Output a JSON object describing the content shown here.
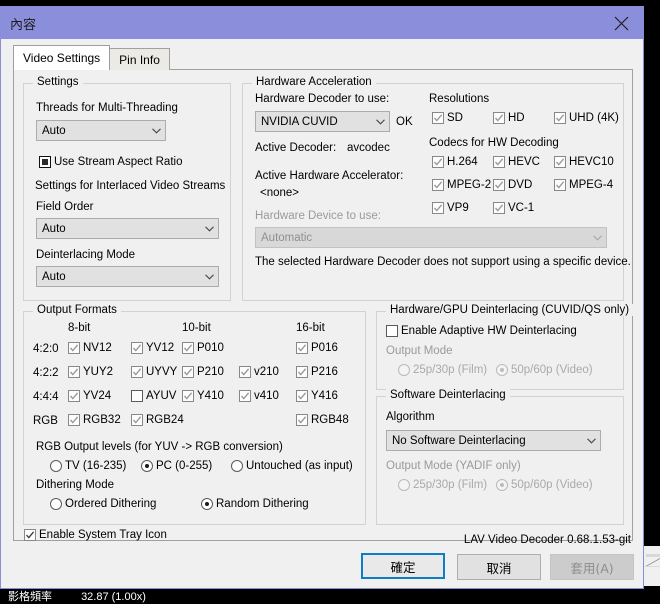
{
  "window": {
    "title": "內容",
    "close_icon": "close-icon"
  },
  "tabs": [
    {
      "label": "Video Settings",
      "active": true
    },
    {
      "label": "Pin Info",
      "active": false
    }
  ],
  "settings_group": {
    "legend": "Settings",
    "threads_label": "Threads for Multi-Threading",
    "threads_value": "Auto",
    "use_stream_aspect_ratio": "Use Stream Aspect Ratio",
    "interlaced_header": "Settings for Interlaced Video Streams",
    "field_order_label": "Field Order",
    "field_order_value": "Auto",
    "deinterlacing_mode_label": "Deinterlacing Mode",
    "deinterlacing_mode_value": "Auto"
  },
  "hw_accel": {
    "legend": "Hardware Acceleration",
    "decoder_label": "Hardware Decoder to use:",
    "decoder_value": "NVIDIA CUVID",
    "ok_text": "OK",
    "active_decoder_label": "Active Decoder:",
    "active_decoder_value": "avcodec",
    "active_accel_label": "Active Hardware Accelerator:",
    "active_accel_value": "<none>",
    "device_label": "Hardware Device to use:",
    "device_value": "Automatic",
    "note": "The selected Hardware Decoder does not support using a specific device.",
    "resolutions_label": "Resolutions",
    "resolutions": [
      {
        "label": "SD",
        "checked": true
      },
      {
        "label": "HD",
        "checked": true
      },
      {
        "label": "UHD (4K)",
        "checked": true
      }
    ],
    "codecs_label": "Codecs for HW Decoding",
    "codecs": [
      {
        "label": "H.264",
        "checked": true
      },
      {
        "label": "HEVC",
        "checked": true
      },
      {
        "label": "HEVC10",
        "checked": true
      },
      {
        "label": "MPEG-2",
        "checked": true
      },
      {
        "label": "DVD",
        "checked": true
      },
      {
        "label": "MPEG-4",
        "checked": true
      },
      {
        "label": "VP9",
        "checked": true
      },
      {
        "label": "VC-1",
        "checked": true
      }
    ]
  },
  "output_formats": {
    "legend": "Output Formats",
    "col_headers": [
      "8-bit",
      "10-bit",
      "16-bit"
    ],
    "row_labels": [
      "4:2:0",
      "4:2:2",
      "4:4:4",
      "RGB"
    ],
    "items": [
      {
        "label": "NV12",
        "checked": true
      },
      {
        "label": "YV12",
        "checked": true
      },
      {
        "label": "P010",
        "checked": true
      },
      {
        "label": "P016",
        "checked": true
      },
      {
        "label": "YUY2",
        "checked": true
      },
      {
        "label": "UYVY",
        "checked": true
      },
      {
        "label": "P210",
        "checked": true
      },
      {
        "label": "v210",
        "checked": true
      },
      {
        "label": "P216",
        "checked": true
      },
      {
        "label": "YV24",
        "checked": true
      },
      {
        "label": "AYUV",
        "checked": false
      },
      {
        "label": "Y410",
        "checked": true
      },
      {
        "label": "v410",
        "checked": true
      },
      {
        "label": "Y416",
        "checked": true
      },
      {
        "label": "RGB32",
        "checked": true
      },
      {
        "label": "RGB24",
        "checked": true
      },
      {
        "label": "RGB48",
        "checked": true
      }
    ],
    "rgb_levels_label": "RGB Output levels (for YUV -> RGB conversion)",
    "rgb_levels": [
      {
        "label": "TV (16-235)",
        "selected": false
      },
      {
        "label": "PC (0-255)",
        "selected": true
      },
      {
        "label": "Untouched (as input)",
        "selected": false
      }
    ],
    "dithering_label": "Dithering Mode",
    "dithering": [
      {
        "label": "Ordered Dithering",
        "selected": false
      },
      {
        "label": "Random Dithering",
        "selected": true
      }
    ]
  },
  "hw_deint": {
    "legend": "Hardware/GPU Deinterlacing (CUVID/QS only)",
    "enable_label": "Enable Adaptive HW Deinterlacing",
    "enable_checked": false,
    "output_mode_label": "Output Mode",
    "modes": [
      {
        "label": "25p/30p (Film)",
        "selected": false
      },
      {
        "label": "50p/60p (Video)",
        "selected": true
      }
    ]
  },
  "sw_deint": {
    "legend": "Software Deinterlacing",
    "algorithm_label": "Algorithm",
    "algorithm_value": "No Software Deinterlacing",
    "output_mode_label": "Output Mode (YADIF only)",
    "modes": [
      {
        "label": "25p/30p (Film)",
        "selected": false
      },
      {
        "label": "50p/60p (Video)",
        "selected": true
      }
    ]
  },
  "footer": {
    "tray_label": "Enable System Tray Icon",
    "tray_checked": true,
    "version": "LAV Video Decoder 0.68.1.53-git",
    "ok_button": "確定",
    "cancel_button": "取消",
    "apply_button": "套用(A)"
  },
  "statusbar": {
    "label": "影格頻率",
    "value": "32.87 (1.00x)"
  }
}
